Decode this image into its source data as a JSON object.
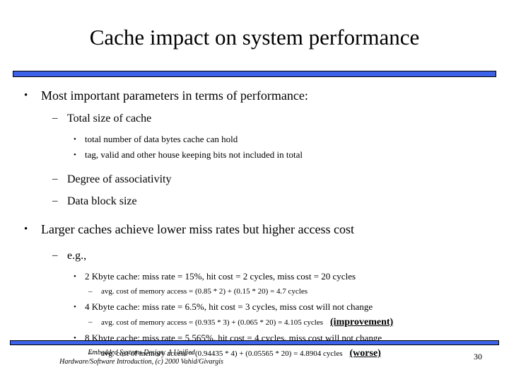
{
  "slide": {
    "title": "Cache impact on system performance",
    "accent_color": "#3B62E8",
    "bullet_glyphs": {
      "disc": "•",
      "dash": "–"
    },
    "content": [
      {
        "level": 1,
        "text": "Most important parameters in terms of performance:"
      },
      {
        "level": 2,
        "text": "Total size of cache"
      },
      {
        "level": 3,
        "text": "total number of data bytes cache can hold"
      },
      {
        "level": 3,
        "text": "tag, valid and other house keeping bits not included in total"
      },
      {
        "level": 2,
        "text": "Degree of associativity"
      },
      {
        "level": 2,
        "text": "Data block size"
      },
      {
        "level": 1,
        "text": "Larger caches achieve lower miss rates but higher access cost"
      },
      {
        "level": 2,
        "text": "e.g.,"
      },
      {
        "level": 3,
        "text": "2 Kbyte cache: miss rate = 15%, hit cost = 2 cycles, miss cost = 20 cycles"
      },
      {
        "level": 4,
        "text": "avg. cost of memory access = (0.85 * 2) + (0.15 * 20) = 4.7 cycles"
      },
      {
        "level": 3,
        "text": "4 Kbyte cache: miss rate = 6.5%, hit cost = 3 cycles, miss cost will not change"
      },
      {
        "level": 4,
        "text": "avg. cost of memory access = (0.935 * 3) + (0.065 * 20) = 4.105 cycles",
        "tag": "(improvement)"
      },
      {
        "level": 3,
        "text": "8 Kbyte cache: miss rate = 5.565%, hit cost = 4 cycles, miss cost will not change"
      },
      {
        "level": 4,
        "text": "avg. cost of memory access = (0.94435 * 4) + (0.05565 * 20) = 4.8904 cycles",
        "tag": "(worse)"
      }
    ]
  },
  "footer": {
    "line1": "Embedded Systems Design: A Unified",
    "line2": "Hardware/Software Introduction, (c) 2000 Vahid/Givargis",
    "page_number": "30"
  }
}
